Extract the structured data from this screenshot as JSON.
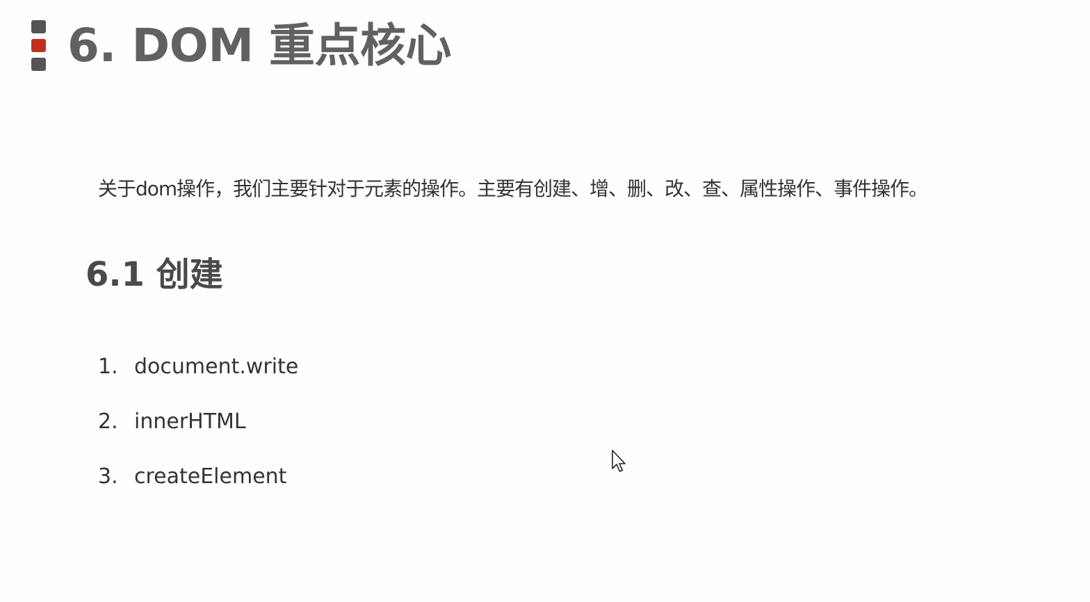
{
  "title": {
    "text": "6. DOM 重点核心"
  },
  "intro": {
    "text": "关于dom操作，我们主要针对于元素的操作。主要有创建、增、删、改、查、属性操作、事件操作。"
  },
  "section": {
    "title": "6.1 创建"
  },
  "list": {
    "items": [
      {
        "num": "1.",
        "text": "document.write"
      },
      {
        "num": "2.",
        "text": "innerHTML"
      },
      {
        "num": "3.",
        "text": "createElement"
      }
    ]
  },
  "icons": {
    "title_marker": "bullet-bar-icon",
    "pointer": "mouse-cursor-icon"
  },
  "colors": {
    "accent": "#c0311d",
    "marker_gray": "#555555",
    "title_gray": "#616161"
  }
}
